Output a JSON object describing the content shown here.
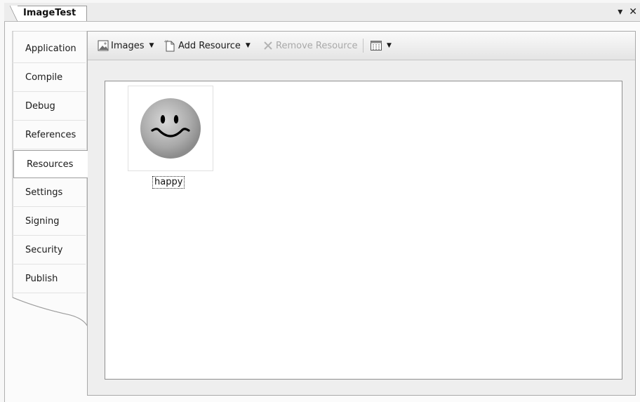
{
  "document_tab": {
    "title": "ImageTest"
  },
  "window_buttons": {
    "dropdown": "▾",
    "close": "✕"
  },
  "sidebar": {
    "active": "Resources",
    "items": [
      {
        "label": "Application"
      },
      {
        "label": "Compile"
      },
      {
        "label": "Debug"
      },
      {
        "label": "References"
      },
      {
        "label": "Resources"
      },
      {
        "label": "Settings"
      },
      {
        "label": "Signing"
      },
      {
        "label": "Security"
      },
      {
        "label": "Publish"
      }
    ]
  },
  "toolbar": {
    "category_label": "Images",
    "add_resource_label": "Add Resource",
    "remove_resource_label": "Remove Resource",
    "remove_enabled": false,
    "view_icon": "grid-view-icon"
  },
  "resources": [
    {
      "name": "happy",
      "icon": "smiley-face-image"
    }
  ]
}
